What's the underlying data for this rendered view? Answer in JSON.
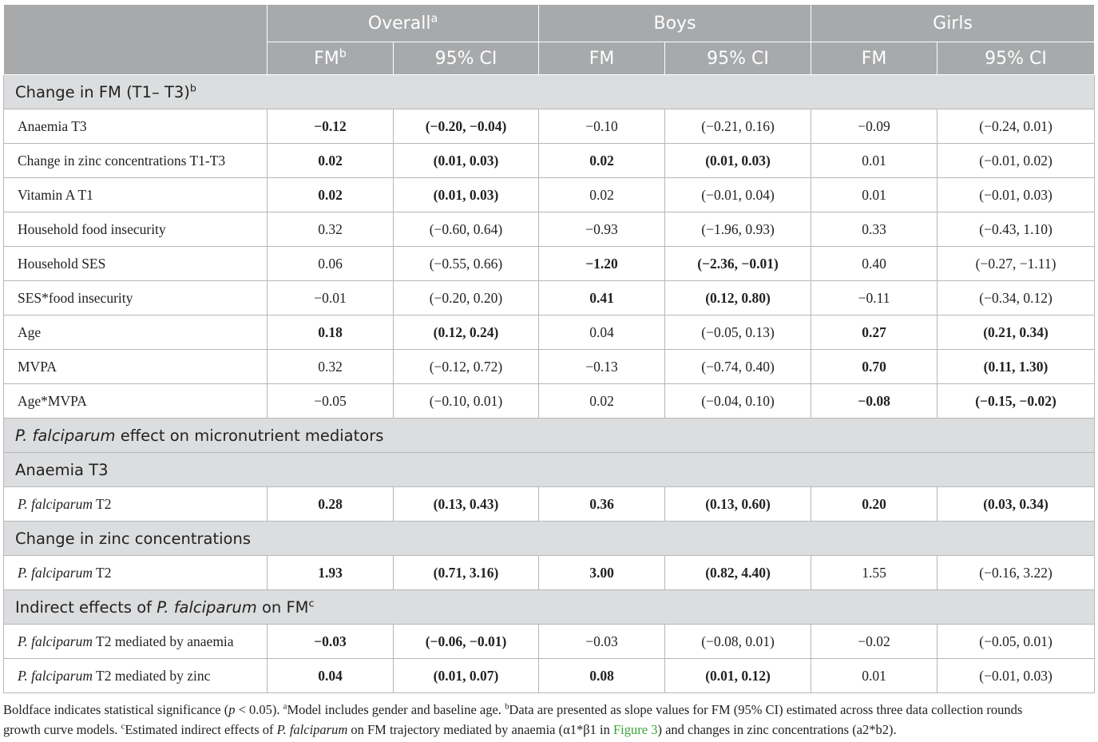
{
  "header": {
    "groups": [
      "Overall",
      "Boys",
      "Girls"
    ],
    "overall_sup": "a",
    "sub": [
      "FM",
      "95% CI",
      "FM",
      "95% CI",
      "FM",
      "95% CI"
    ],
    "fm_sup": "b"
  },
  "sections": {
    "s1_text": "Change in FM (T1– T3)",
    "s1_sup": "b",
    "s2_italic": "P. falciparum",
    "s2_rest": " effect on micronutrient mediators",
    "s3_text": "Anaemia T3",
    "s4_text": "Change in zinc concentrations",
    "s5_pre": "Indirect effects of ",
    "s5_italic": "P. falciparum",
    "s5_post": " on FM",
    "s5_sup": "c"
  },
  "rows_fm": [
    {
      "label": "Anaemia T3",
      "cells": [
        "−0.12",
        "(−0.20, −0.04)",
        "−0.10",
        "(−0.21, 0.16)",
        "−0.09",
        "(−0.24, 0.01)"
      ],
      "bold": [
        1,
        1,
        0,
        0,
        0,
        0
      ]
    },
    {
      "label": "Change in zinc concentrations T1-T3",
      "cells": [
        "0.02",
        "(0.01, 0.03)",
        "0.02",
        "(0.01, 0.03)",
        "0.01",
        "(−0.01, 0.02)"
      ],
      "bold": [
        1,
        1,
        1,
        1,
        0,
        0
      ]
    },
    {
      "label": "Vitamin A T1",
      "cells": [
        "0.02",
        "(0.01, 0.03)",
        "0.02",
        "(−0.01, 0.04)",
        "0.01",
        "(−0.01, 0.03)"
      ],
      "bold": [
        1,
        1,
        0,
        0,
        0,
        0
      ]
    },
    {
      "label": "Household food insecurity",
      "cells": [
        "0.32",
        "(−0.60, 0.64)",
        "−0.93",
        "(−1.96, 0.93)",
        "0.33",
        "(−0.43, 1.10)"
      ],
      "bold": [
        0,
        0,
        0,
        0,
        0,
        0
      ]
    },
    {
      "label": "Household SES",
      "cells": [
        "0.06",
        "(−0.55, 0.66)",
        "−1.20",
        "(−2.36, −0.01)",
        "0.40",
        "(−0.27, −1.11)"
      ],
      "bold": [
        0,
        0,
        1,
        1,
        0,
        0
      ]
    },
    {
      "label": "SES*food insecurity",
      "cells": [
        "−0.01",
        "(−0.20, 0.20)",
        "0.41",
        "(0.12, 0.80)",
        "−0.11",
        "(−0.34, 0.12)"
      ],
      "bold": [
        0,
        0,
        1,
        1,
        0,
        0
      ]
    },
    {
      "label": "Age",
      "cells": [
        "0.18",
        "(0.12, 0.24)",
        "0.04",
        "(−0.05, 0.13)",
        "0.27",
        "(0.21, 0.34)"
      ],
      "bold": [
        1,
        1,
        0,
        0,
        1,
        1
      ]
    },
    {
      "label": "MVPA",
      "cells": [
        "0.32",
        "(−0.12, 0.72)",
        "−0.13",
        "(−0.74, 0.40)",
        "0.70",
        "(0.11, 1.30)"
      ],
      "bold": [
        0,
        0,
        0,
        0,
        1,
        1
      ]
    },
    {
      "label": "Age*MVPA",
      "cells": [
        "−0.05",
        "(−0.10, 0.01)",
        "0.02",
        "(−0.04, 0.10)",
        "−0.08",
        "(−0.15, −0.02)"
      ],
      "bold": [
        0,
        0,
        0,
        0,
        1,
        1
      ]
    }
  ],
  "row_anaemia": {
    "label_italic": "P. falciparum",
    "label_rest": " T2",
    "cells": [
      "0.28",
      "(0.13, 0.43)",
      "0.36",
      "(0.13, 0.60)",
      "0.20",
      "(0.03, 0.34)"
    ],
    "bold": [
      1,
      1,
      1,
      1,
      1,
      1
    ]
  },
  "row_zinc": {
    "label_italic": "P. falciparum",
    "label_rest": " T2",
    "cells": [
      "1.93",
      "(0.71, 3.16)",
      "3.00",
      "(0.82, 4.40)",
      "1.55",
      "(−0.16, 3.22)"
    ],
    "bold": [
      1,
      1,
      1,
      1,
      0,
      0
    ]
  },
  "rows_indirect": [
    {
      "label_italic": "P. falciparum",
      "label_rest": " T2 mediated by anaemia",
      "cells": [
        "−0.03",
        "(−0.06, −0.01)",
        "−0.03",
        "(−0.08, 0.01)",
        "−0.02",
        "(−0.05, 0.01)"
      ],
      "bold": [
        1,
        1,
        0,
        0,
        0,
        0
      ]
    },
    {
      "label_italic": "P. falciparum",
      "label_rest": " T2 mediated by zinc",
      "cells": [
        "0.04",
        "(0.01, 0.07)",
        "0.08",
        "(0.01, 0.12)",
        "0.01",
        "(−0.01, 0.03)"
      ],
      "bold": [
        1,
        1,
        1,
        1,
        0,
        0
      ]
    }
  ],
  "footnote": {
    "l1_pre": "Boldface indicates statistical significance (",
    "l1_p": "p",
    "l1_mid": " < 0.05). ",
    "a_sup": "a",
    "a_text": "Model includes gender and baseline age. ",
    "b_sup": "b",
    "b_text": "Data are presented as slope values for FM (95% CI) estimated across three data collection rounds",
    "l2_pre": "growth curve models. ",
    "c_sup": "c",
    "c_text": "Estimated indirect effects of ",
    "c_italic": "P. falciparum",
    "c_text2": " on FM trajectory mediated by anaemia (α1*β1 in ",
    "fig_link": "Figure 3",
    "c_text3": ") and changes in zinc concentrations (a2*b2)."
  }
}
